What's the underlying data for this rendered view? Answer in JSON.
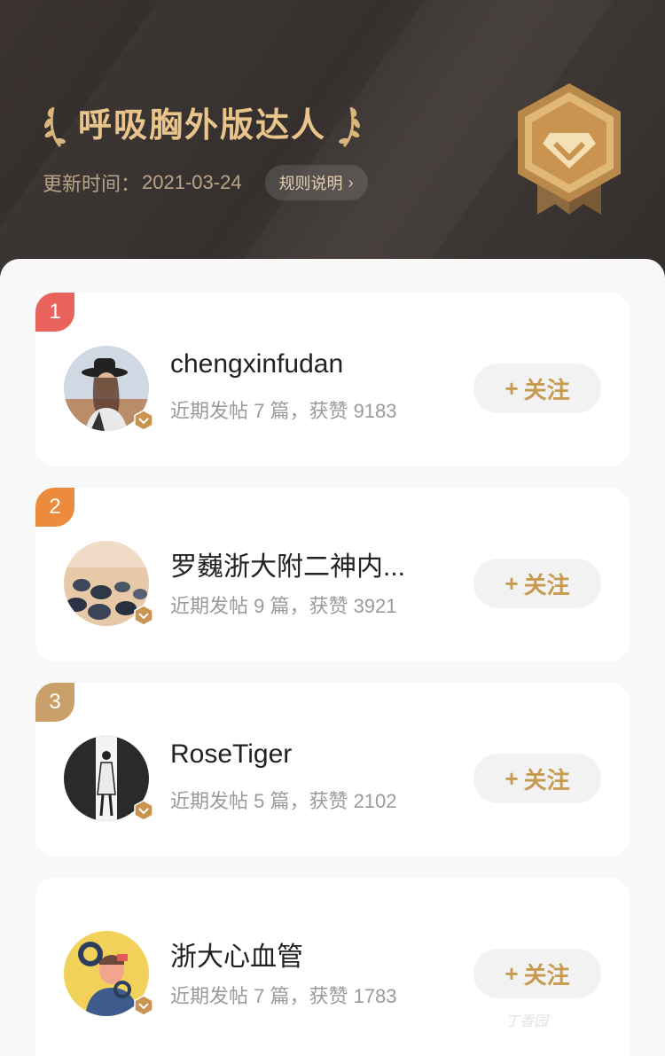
{
  "header": {
    "title": "呼吸胸外版达人",
    "update_label": "更新时间：",
    "update_date": "2021-03-24",
    "rules_button": "规则说明",
    "colors": {
      "gold": "#e9c58c",
      "bg": "#2f2a28"
    }
  },
  "rank_colors": [
    "#e9625c",
    "#ec8b3c",
    "#c9a06a",
    "#ffffff"
  ],
  "list": [
    {
      "rank": "1",
      "name": "chengxinfudan",
      "stats": "近期发帖 7 篇，获赞 9183",
      "follow": "关注",
      "avatar_icon": "avatar-woman-hat"
    },
    {
      "rank": "2",
      "name": "罗巍浙大附二神内...",
      "stats": "近期发帖 9 篇，获赞 3921",
      "follow": "关注",
      "avatar_icon": "avatar-stones"
    },
    {
      "rank": "3",
      "name": "RoseTiger",
      "stats": "近期发帖 5 篇，获赞 2102",
      "follow": "关注",
      "avatar_icon": "avatar-figure"
    },
    {
      "rank": "",
      "name": "浙大心血管",
      "stats": "近期发帖 7 篇，获赞 1783",
      "follow": "关注",
      "avatar_icon": "avatar-cartoon"
    }
  ],
  "follow_plus": "+",
  "watermark": "丁香园"
}
